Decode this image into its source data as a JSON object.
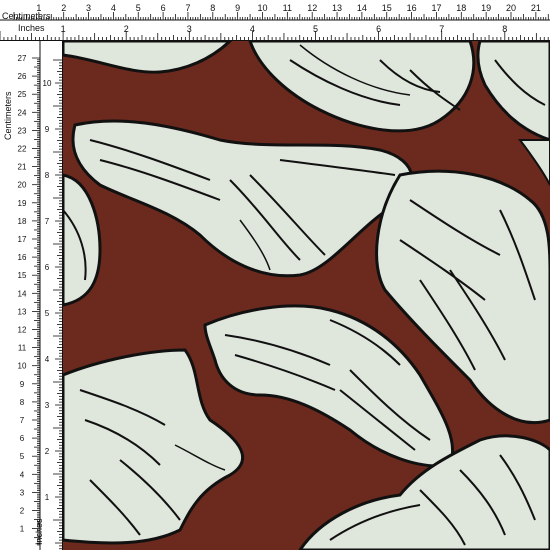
{
  "ruler": {
    "top_unit_label": "Centimeters",
    "top_unit_label_2": "Inches",
    "left_unit_label": "Centimeters",
    "left_unit_label_2": "Inches",
    "cm_ticks": [
      "1",
      "2",
      "3",
      "4",
      "5",
      "6",
      "7",
      "8",
      "9",
      "10",
      "11",
      "12",
      "13",
      "14",
      "15",
      "16",
      "17",
      "18",
      "19",
      "20",
      "21"
    ],
    "inch_ticks": [
      "1",
      "2",
      "3",
      "4",
      "5",
      "6",
      "7",
      "8"
    ],
    "left_cm_ticks": [
      "27",
      "26",
      "25",
      "24",
      "23",
      "22",
      "21",
      "20",
      "19",
      "18",
      "17",
      "16",
      "15",
      "14",
      "13",
      "12",
      "11",
      "10",
      "9",
      "8",
      "7",
      "6",
      "5",
      "4",
      "3",
      "2",
      "1"
    ],
    "left_inch_ticks": [
      "10",
      "9",
      "8",
      "7",
      "6",
      "5",
      "4",
      "3",
      "2",
      "1"
    ]
  },
  "fabric": {
    "background_color": "#6b2a1d",
    "petal_color": "#dfe6db",
    "line_color": "#111111",
    "pattern": "large-floral-outline"
  },
  "colors": {
    "ruler_bg": "#ffffff",
    "ruler_ink": "#111111"
  }
}
